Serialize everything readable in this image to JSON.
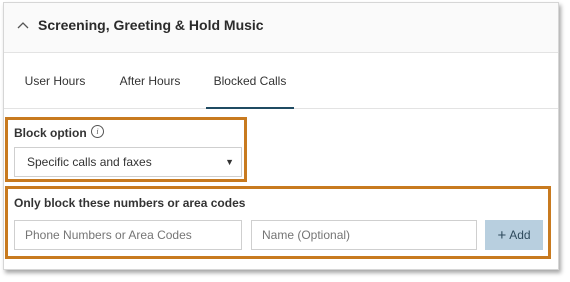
{
  "section": {
    "title": "Screening, Greeting & Hold Music",
    "toggle_icon": "chevron-up-icon"
  },
  "tabs": [
    {
      "label": "User Hours",
      "active": false
    },
    {
      "label": "After Hours",
      "active": false
    },
    {
      "label": "Blocked Calls",
      "active": true
    }
  ],
  "block_option": {
    "label": "Block option",
    "info_icon": "i",
    "selected": "Specific calls and faxes"
  },
  "block_numbers": {
    "label": "Only block these numbers or area codes",
    "number_placeholder": "Phone Numbers or Area Codes",
    "name_placeholder": "Name (Optional)",
    "add_label": "Add",
    "add_icon": "+"
  },
  "colors": {
    "highlight": "#c87a1f",
    "active_tab_underline": "#1f4b62",
    "add_button": "#b8cfdf"
  }
}
